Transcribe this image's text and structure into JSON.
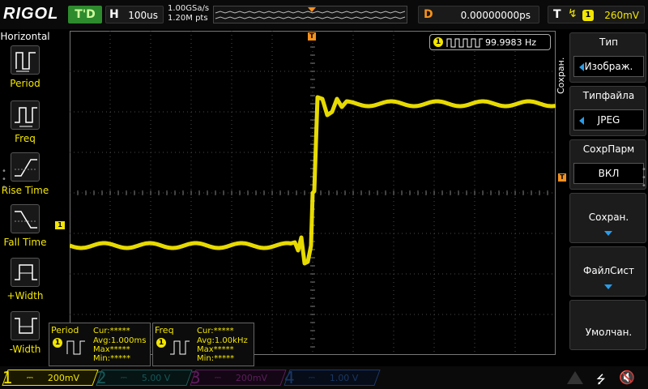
{
  "brand": {
    "logo": "RIGOL"
  },
  "top_bar": {
    "run_status": "T'D",
    "horizontal": {
      "label": "H",
      "value": "100us"
    },
    "sample_rate": "1.00GSa/s",
    "memory_depth": "1.20M pts",
    "delay": {
      "label": "D",
      "value": "0.00000000ps"
    },
    "trigger": {
      "label": "T",
      "source": "1",
      "level": "260mV"
    }
  },
  "left_panel": {
    "title": "Horizontal",
    "items": [
      {
        "label": "Period",
        "icon": "period-icon"
      },
      {
        "label": "Freq",
        "icon": "freq-icon"
      },
      {
        "label": "Rise Time",
        "icon": "rise-time-icon"
      },
      {
        "label": "Fall Time",
        "icon": "fall-time-icon"
      },
      {
        "label": "+Width",
        "icon": "positive-width-icon"
      },
      {
        "label": "-Width",
        "icon": "negative-width-icon"
      }
    ]
  },
  "frequency_counter": {
    "channel": "1",
    "value": "99.9983 Hz"
  },
  "right_menu": {
    "title": "Сохран.",
    "items": [
      {
        "title": "Тип",
        "value": "Изображ."
      },
      {
        "title": "Типфайла",
        "value": "JPEG"
      },
      {
        "title": "СохрПарм",
        "value": "ВКЛ"
      },
      {
        "title": "Сохран."
      },
      {
        "title": "ФайлСист"
      },
      {
        "title": "Умолчан."
      }
    ]
  },
  "measurements": [
    {
      "name": "Period",
      "channel": "1",
      "cur": "Cur:*****",
      "avg": "Avg:1.000ms",
      "max": "Max*****",
      "min": "Min:*****"
    },
    {
      "name": "Freq",
      "channel": "1",
      "cur": "Cur:*****",
      "avg": "Avg:1.00kHz",
      "max": "Max*****",
      "min": "Min:*****"
    }
  ],
  "channels": [
    {
      "num": "1",
      "scale": "200mV",
      "color": "#f3e600",
      "active": true
    },
    {
      "num": "2",
      "scale": "5.00 V",
      "color": "#2ec4c4",
      "active": false
    },
    {
      "num": "3",
      "scale": "200mV",
      "color": "#d040d0",
      "active": false
    },
    {
      "num": "4",
      "scale": "1.00 V",
      "color": "#3a7be0",
      "active": false
    }
  ],
  "colors": {
    "ch1": "#f3e600",
    "trigger": "#f6921e",
    "menu_arrow": "#2a9ce8",
    "grid": "#4a4a4a"
  },
  "waveform": {
    "channel": "1",
    "shape": "square-edge-rising",
    "low_level_div": -1.3,
    "high_level_div": 2.2
  }
}
